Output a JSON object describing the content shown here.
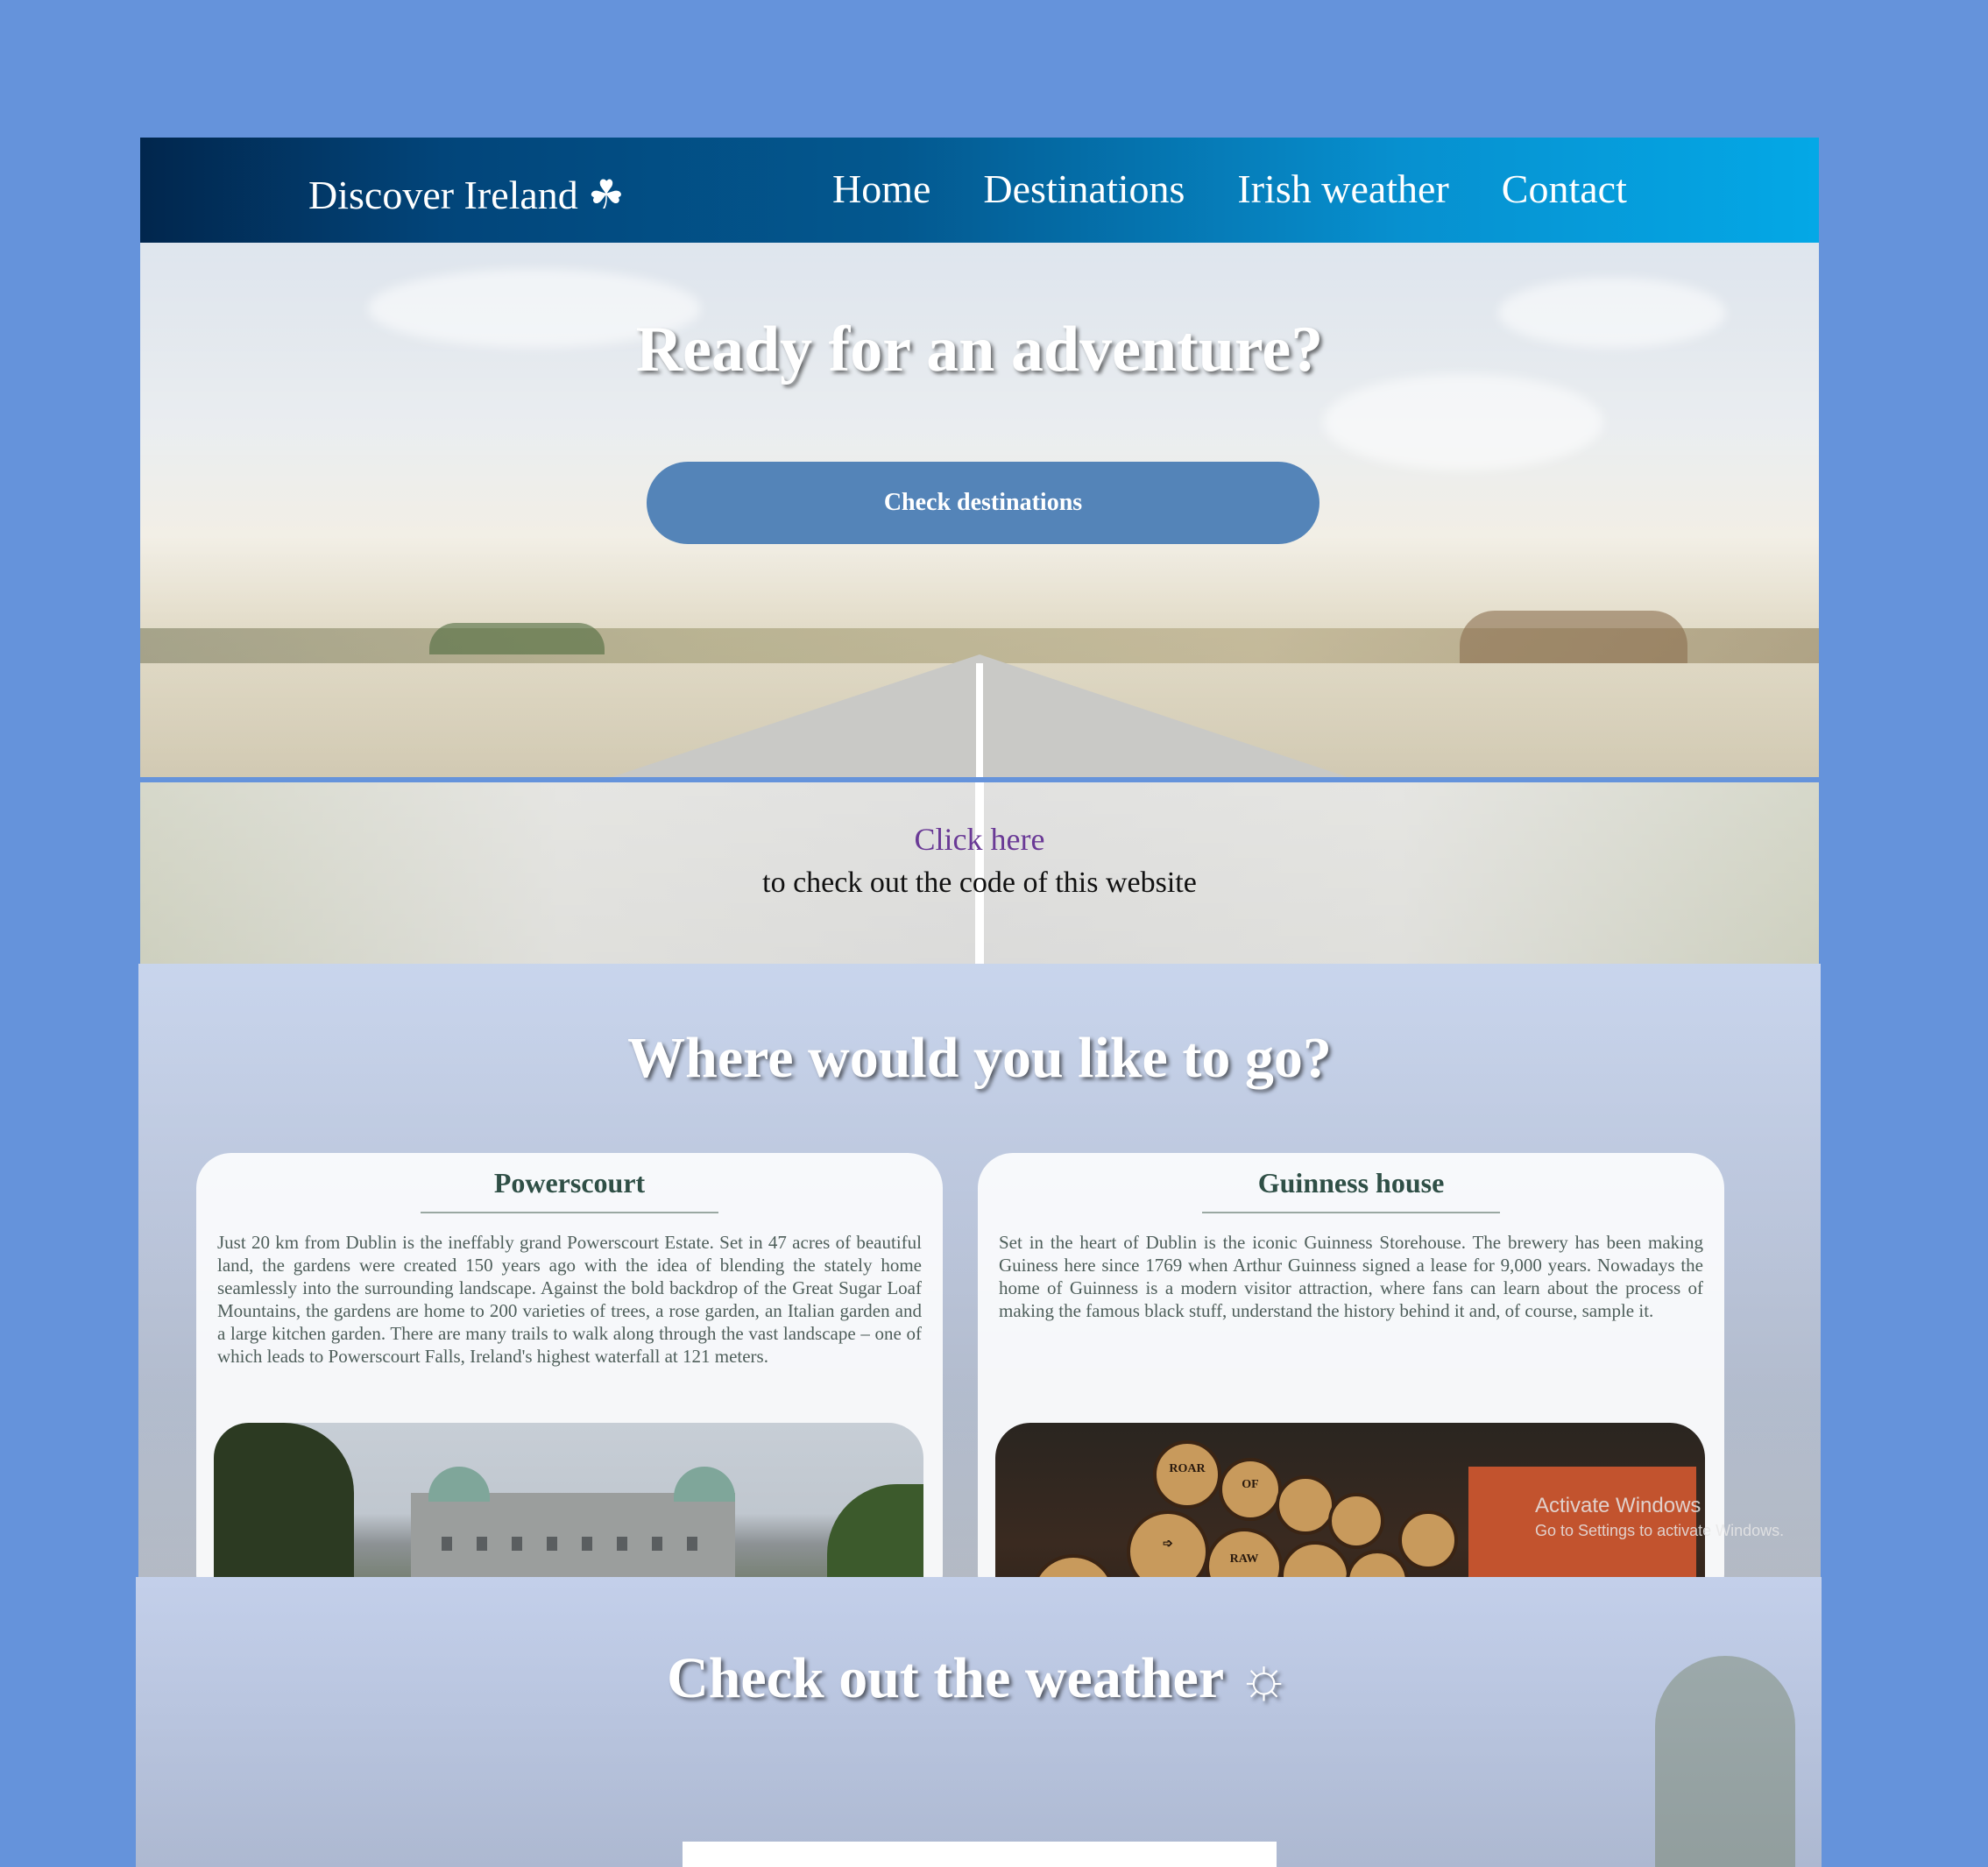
{
  "nav": {
    "brand": "Discover Ireland ☘",
    "links": [
      "Home",
      "Destinations",
      "Irish weather",
      "Contact"
    ]
  },
  "hero": {
    "title": "Ready for an adventure?",
    "button": "Check destinations"
  },
  "code": {
    "link": "Click here",
    "text": "to check out the code of this website"
  },
  "destinations": {
    "title": "Where would you like to go?",
    "cards": [
      {
        "title": "Powerscourt",
        "text": "Just 20 km from Dublin is the ineffably grand Powerscourt Estate. Set in 47 acres of beautiful land, the gardens were created 150 years ago with the idea of blending the stately home seamlessly into the surrounding landscape. Against the bold backdrop of the Great Sugar Loaf Mountains, the gardens are home to 200 varieties of trees, a rose garden, an Italian garden and a large kitchen garden. There are many trails to walk along through the vast landscape – one of which leads to Powerscourt Falls, Ireland's highest waterfall at 121 meters."
      },
      {
        "title": "Guinness house",
        "text": "Set in the heart of Dublin is the iconic Guinness Storehouse. The brewery has been making Guiness here since 1769 when Arthur Guinness signed a lease for 9,000 years. Nowadays the home of Guinness is a modern visitor attraction, where fans can learn about the process of making the famous black stuff, understand the history behind it and, of course, sample it."
      }
    ],
    "barrel_labels": [
      "ROAR",
      "OF",
      "RAW",
      "➩"
    ]
  },
  "weather": {
    "title": "Check out the weather ☼"
  },
  "watermark": {
    "line1": "Activate Windows",
    "line2": "Go to Settings to activate Windows."
  },
  "colors": {
    "page_bg": "#6593db",
    "button_bg": "#5484b8",
    "card_title": "#2f4f46"
  }
}
